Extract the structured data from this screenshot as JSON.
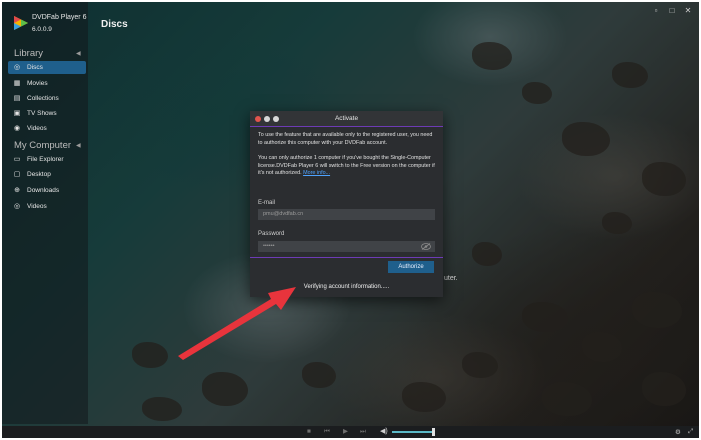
{
  "app": {
    "name": "DVDFab Player 6",
    "version": "6.0.0.9",
    "page_title": "Discs"
  },
  "window_controls": [
    "restore-icon",
    "maximize-icon",
    "close-icon"
  ],
  "sidebar": {
    "library_header": "Library",
    "library_items": [
      {
        "label": "Discs",
        "icon": "disc-icon",
        "active": true
      },
      {
        "label": "Movies",
        "icon": "movies-icon",
        "active": false
      },
      {
        "label": "Collections",
        "icon": "collections-icon",
        "active": false
      },
      {
        "label": "TV Shows",
        "icon": "tv-icon",
        "active": false
      },
      {
        "label": "Videos",
        "icon": "videos-icon",
        "active": false
      }
    ],
    "computer_header": "My Computer",
    "computer_items": [
      {
        "label": "File Explorer",
        "icon": "file-explorer-icon"
      },
      {
        "label": "Desktop",
        "icon": "desktop-icon"
      },
      {
        "label": "Downloads",
        "icon": "downloads-icon"
      },
      {
        "label": "Videos",
        "icon": "videos-icon"
      }
    ]
  },
  "dialog": {
    "title": "Activate",
    "para1": "To use the feature that are available only to the registered user, you need to authorize this computer with your DVDFab account.",
    "para2": "You can only authorize 1 computer if you've bought the Single-Computer license.DVDFab Player 6 will switch to the Free version on the computer if it's not authorized.",
    "more_info": "More info...",
    "email_label": "E-mail",
    "email_value": "pmu@dvdfab.cn",
    "password_label": "Password",
    "password_value": "••••••",
    "authorize_label": "Authorize",
    "status": "Verifying account information....."
  },
  "behind_text": "uter.",
  "colors": {
    "accent": "#1f5f8c",
    "dialog_divider": "#6d3bb5",
    "link": "#4ea3ff",
    "arrow": "#e8343c",
    "volume": "#5bb9c7"
  }
}
